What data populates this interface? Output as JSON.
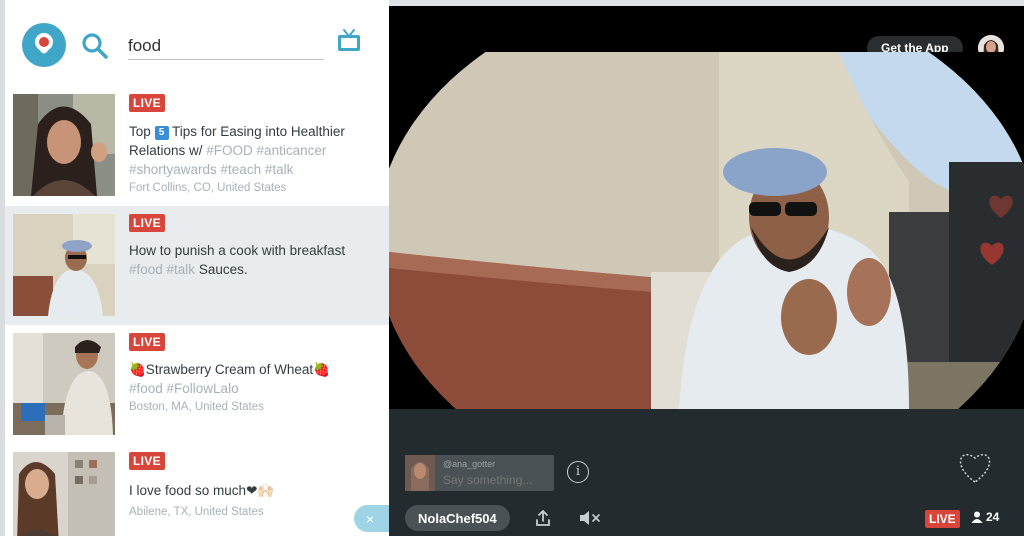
{
  "search": {
    "query": "food"
  },
  "results": [
    {
      "badge": "LIVE",
      "title_parts": [
        "Top ",
        "5",
        " Tips for Easing into Healthier Relations w/ ",
        "#FOOD #anticancer #shortyawards #teach #talk"
      ],
      "location": "Fort Collins, CO, United States"
    },
    {
      "badge": "LIVE",
      "title_main": "How to punish a cook with breakfast",
      "title_tags": "#food #talk",
      "title_tail": " Sauces.",
      "location": ""
    },
    {
      "badge": "LIVE",
      "title_main": "🍓Strawberry Cream of Wheat🍓",
      "title_tags": "#food #FollowLalo",
      "location": "Boston, MA, United States"
    },
    {
      "badge": "LIVE",
      "title_main": "I love food so much❤🙌🏻",
      "location": "Abilene, TX, United States"
    }
  ],
  "close_label": "×",
  "player": {
    "get_app_label": "Get the App",
    "comment_user": "@ana_gotter",
    "comment_placeholder": "Say something...",
    "info_label": "i",
    "broadcaster": "NolaChef504",
    "live_label": "LIVE",
    "viewer_count": "24"
  },
  "colors": {
    "accent": "#3fa6c8",
    "live": "#d8453b",
    "tag": "#a6b2b8"
  }
}
